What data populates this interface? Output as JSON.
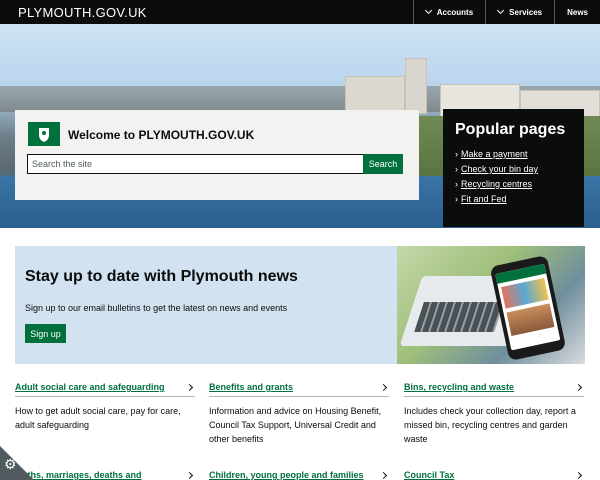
{
  "header": {
    "logo": "PLYMOUTH.GOV.UK",
    "nav": [
      {
        "label": "Accounts",
        "icon": "chevron-down-icon"
      },
      {
        "label": "Services",
        "icon": "chevron-down-icon"
      },
      {
        "label": "News"
      }
    ]
  },
  "welcome": {
    "title": "Welcome to PLYMOUTH.GOV.UK",
    "search_placeholder": "Search the site",
    "search_button": "Search"
  },
  "popular": {
    "title": "Popular pages",
    "links": [
      "Make a payment",
      "Check your bin day",
      "Recycling centres",
      "Fit and Fed"
    ]
  },
  "news": {
    "title": "Stay up to date with Plymouth news",
    "text": "Sign up to our email bulletins to get the latest on news and events",
    "button": "Sign up"
  },
  "services": [
    {
      "title": "Adult social care and safeguarding",
      "desc": "How to get adult social care, pay for care, adult safeguarding"
    },
    {
      "title": "Benefits and grants",
      "desc": "Information and advice on Housing Benefit, Council Tax Support, Universal Credit and other benefits"
    },
    {
      "title": "Bins, recycling and waste",
      "desc": "Includes check your collection day, report a missed bin, recycling centres and garden waste"
    },
    {
      "title": "Births, marriages, deaths and",
      "desc": ""
    },
    {
      "title": "Children, young people and families",
      "desc": ""
    },
    {
      "title": "Council Tax",
      "desc": ""
    }
  ],
  "colors": {
    "brand_green": "#00703c",
    "header_black": "#0b0c0c",
    "news_blue": "#d2e2f1"
  }
}
